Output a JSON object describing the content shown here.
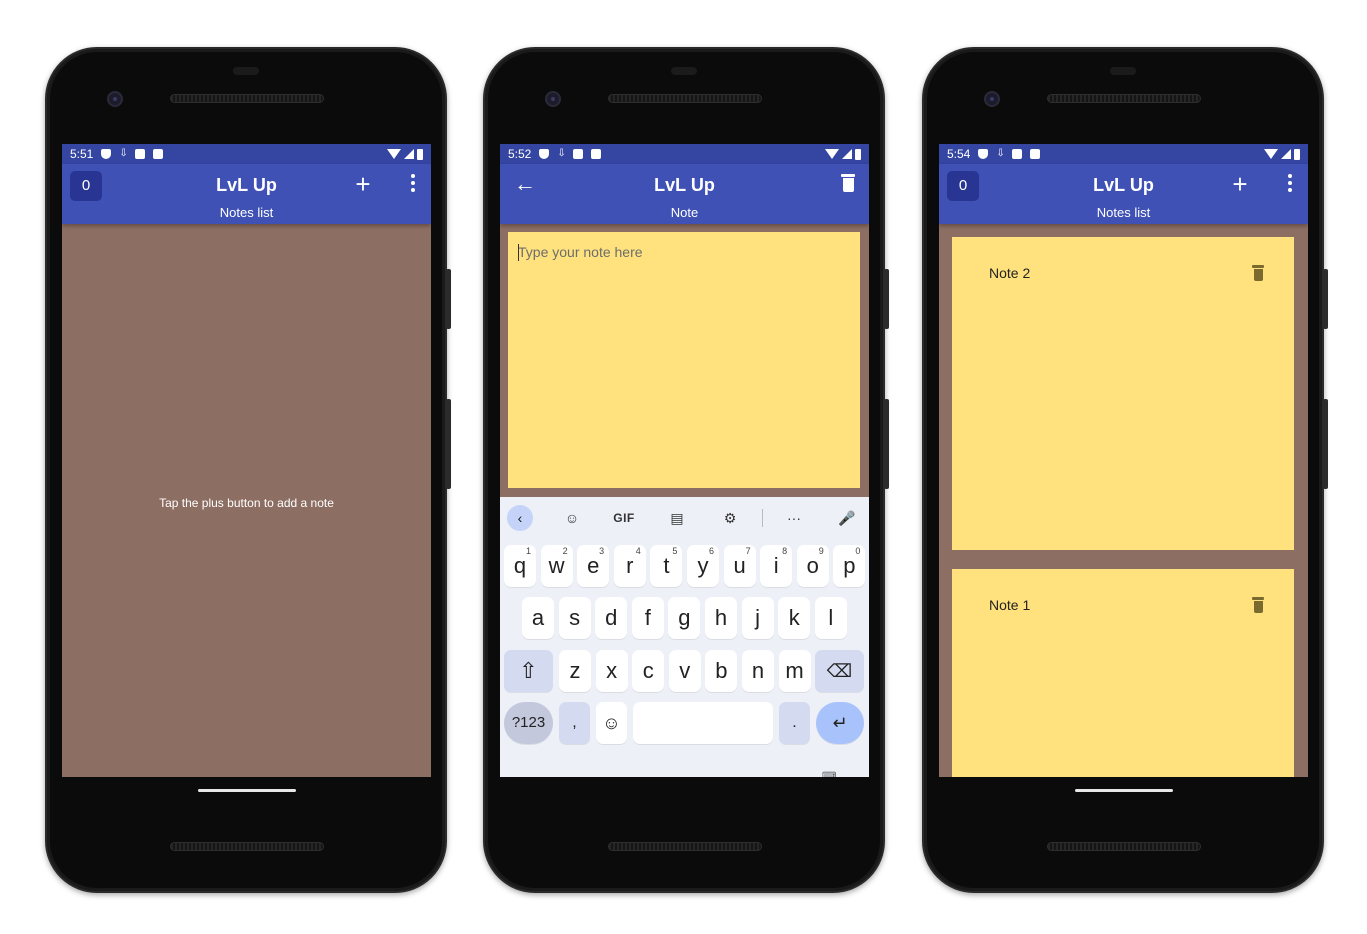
{
  "phones": [
    {
      "status_time": "5:51",
      "app_title": "LvL Up",
      "subtitle": "Notes list",
      "badge_count": "0",
      "empty_message": "Tap the plus button to add a note",
      "plus_label": "+"
    },
    {
      "status_time": "5:52",
      "app_title": "LvL Up",
      "subtitle": "Note",
      "back_label": "←",
      "note_placeholder": "Type your note here",
      "keyboard": {
        "toolbar": [
          "back-chevron",
          "sticker",
          "GIF",
          "clipboard",
          "settings",
          "more",
          "mic"
        ],
        "gif_label": "GIF",
        "row1": [
          {
            "key": "q",
            "hint": "1"
          },
          {
            "key": "w",
            "hint": "2"
          },
          {
            "key": "e",
            "hint": "3"
          },
          {
            "key": "r",
            "hint": "4"
          },
          {
            "key": "t",
            "hint": "5"
          },
          {
            "key": "y",
            "hint": "6"
          },
          {
            "key": "u",
            "hint": "7"
          },
          {
            "key": "i",
            "hint": "8"
          },
          {
            "key": "o",
            "hint": "9"
          },
          {
            "key": "p",
            "hint": "0"
          }
        ],
        "row2": [
          "a",
          "s",
          "d",
          "f",
          "g",
          "h",
          "j",
          "k",
          "l"
        ],
        "row3": [
          "z",
          "x",
          "c",
          "v",
          "b",
          "n",
          "m"
        ],
        "num_label": "?123",
        "comma_label": ",",
        "period_label": ".",
        "enter_label": "↵"
      }
    },
    {
      "status_time": "5:54",
      "app_title": "LvL Up",
      "subtitle": "Notes list",
      "badge_count": "0",
      "plus_label": "+",
      "notes": [
        {
          "title": "Note 2"
        },
        {
          "title": "Note 1"
        }
      ]
    }
  ],
  "colors": {
    "app_bar": "#3f51b5",
    "status_bar": "#3545a2",
    "background": "#8d6e63",
    "note": "#ffe27d",
    "badge": "#283593"
  }
}
